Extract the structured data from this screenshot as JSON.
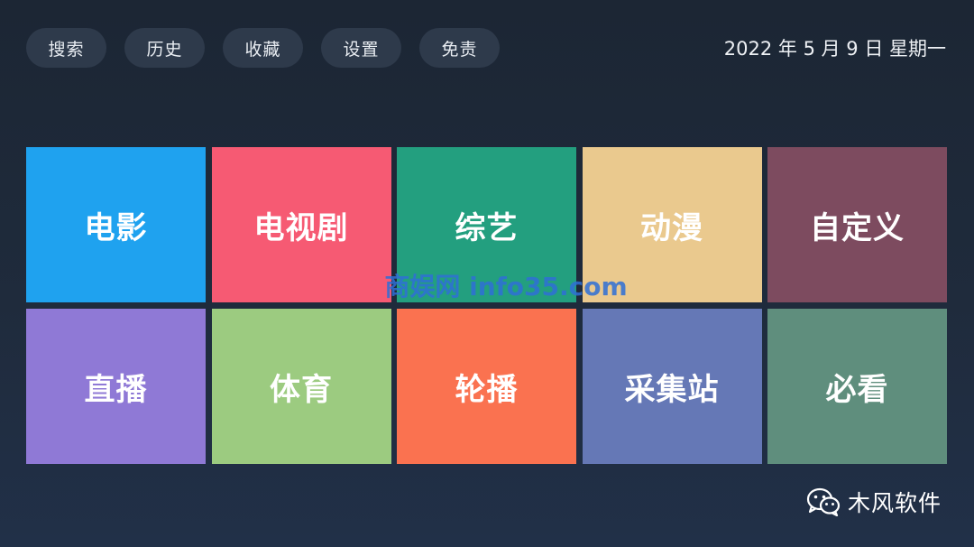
{
  "topbar": {
    "buttons": [
      {
        "label": "搜索"
      },
      {
        "label": "历史"
      },
      {
        "label": "收藏"
      },
      {
        "label": "设置"
      },
      {
        "label": "免责"
      }
    ],
    "date": "2022 年 5 月 9 日 星期一"
  },
  "tiles": [
    {
      "label": "电影",
      "color": "#1fa2ef"
    },
    {
      "label": "电视剧",
      "color": "#f65a73"
    },
    {
      "label": "综艺",
      "color": "#239f7f"
    },
    {
      "label": "动漫",
      "color": "#eac98e"
    },
    {
      "label": "自定义",
      "color": "#7d4b5f"
    },
    {
      "label": "直播",
      "color": "#8f79d6"
    },
    {
      "label": "体育",
      "color": "#9ccb80"
    },
    {
      "label": "轮播",
      "color": "#fa7250"
    },
    {
      "label": "采集站",
      "color": "#6578b6"
    },
    {
      "label": "必看",
      "color": "#5f8e7d"
    }
  ],
  "watermark": "商娱网 info35.com",
  "brand": {
    "icon": "wechat-icon",
    "name": "木风软件"
  }
}
